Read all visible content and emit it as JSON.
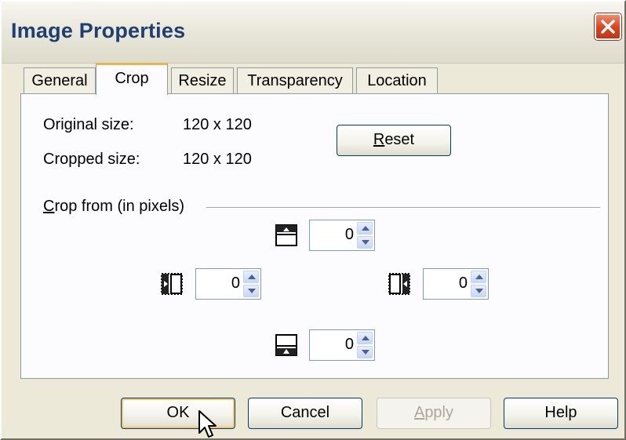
{
  "window": {
    "title": "Image Properties"
  },
  "tabs": [
    "General",
    "Crop",
    "Resize",
    "Transparency",
    "Location"
  ],
  "active_tab": "Crop",
  "crop": {
    "original_size_label": "Original size:",
    "original_size_value": "120 x 120",
    "cropped_size_label": "Cropped size:",
    "cropped_size_value": "120 x 120",
    "reset_button": {
      "underline": "R",
      "rest": "eset"
    },
    "group_label": {
      "underline": "C",
      "rest": "rop from (in pixels)"
    },
    "top": "0",
    "left": "0",
    "right": "0",
    "bottom": "0"
  },
  "buttons": {
    "ok": "OK",
    "cancel": "Cancel",
    "apply": {
      "underline": "A",
      "rest": "pply"
    },
    "help": "Help"
  },
  "icons": {
    "close": "close-x-icon",
    "crop_top": "crop-top-icon",
    "crop_left": "crop-left-icon",
    "crop_right": "crop-right-icon",
    "crop_bottom": "crop-bottom-icon",
    "spin_up": "spin-up-arrow-icon",
    "spin_down": "spin-down-arrow-icon",
    "cursor": "mouse-pointer-icon"
  },
  "colors": {
    "title_text": "#1f3f73",
    "close_button": "#d9421c",
    "active_tab_accent": "#e9b64b",
    "button_border": "#003c74"
  }
}
